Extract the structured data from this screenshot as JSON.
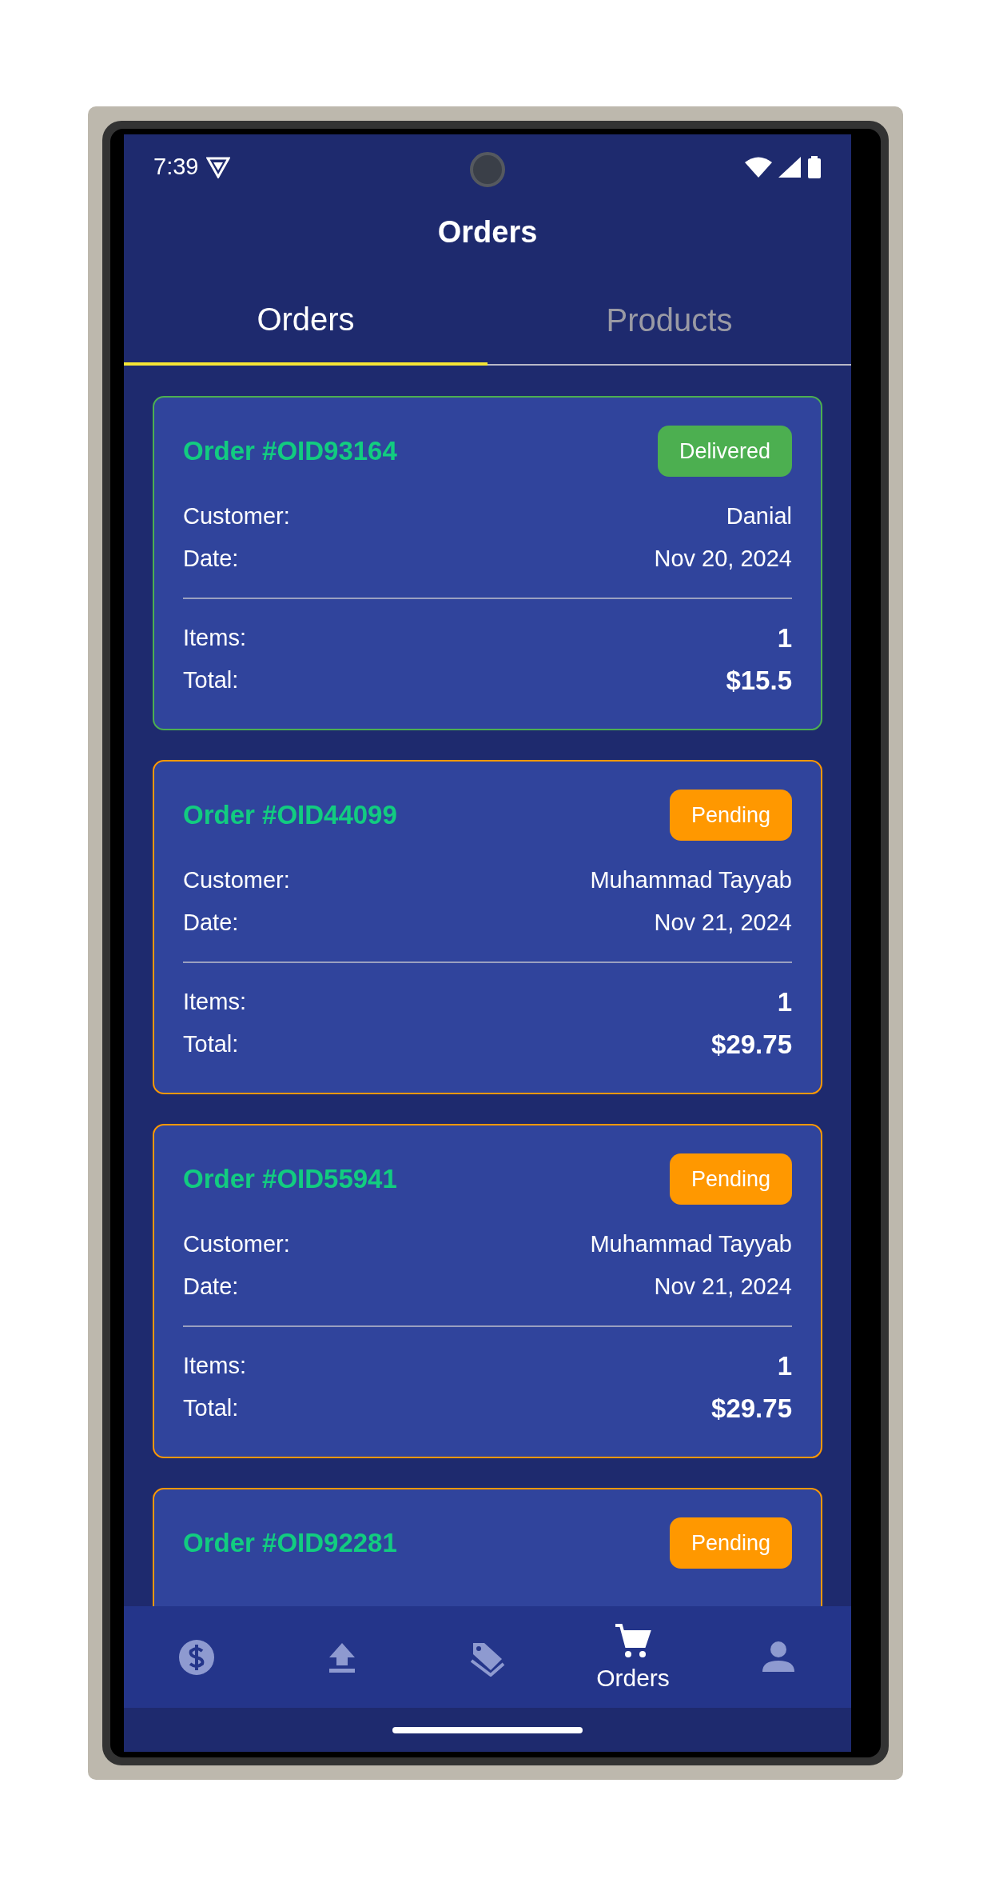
{
  "status_bar": {
    "time": "7:39"
  },
  "title": "Orders",
  "tabs": [
    {
      "label": "Orders",
      "selected": true
    },
    {
      "label": "Products",
      "selected": false
    }
  ],
  "orders": [
    {
      "title": "Order #OID93164",
      "status": "Delivered",
      "kind": "delivered",
      "details": [
        {
          "label": "Customer:",
          "value": "Danial"
        },
        {
          "label": "Date:",
          "value": "Nov 20, 2024"
        }
      ],
      "summary": [
        {
          "label": "Items:",
          "value": "1"
        },
        {
          "label": "Total:",
          "value": "$15.5"
        }
      ]
    },
    {
      "title": "Order #OID44099",
      "status": "Pending",
      "kind": "pending",
      "details": [
        {
          "label": "Customer:",
          "value": "Muhammad Tayyab"
        },
        {
          "label": "Date:",
          "value": "Nov 21, 2024"
        }
      ],
      "summary": [
        {
          "label": "Items:",
          "value": "1"
        },
        {
          "label": "Total:",
          "value": "$29.75"
        }
      ]
    },
    {
      "title": "Order #OID55941",
      "status": "Pending",
      "kind": "pending",
      "details": [
        {
          "label": "Customer:",
          "value": "Muhammad Tayyab"
        },
        {
          "label": "Date:",
          "value": "Nov 21, 2024"
        }
      ],
      "summary": [
        {
          "label": "Items:",
          "value": "1"
        },
        {
          "label": "Total:",
          "value": "$29.75"
        }
      ]
    },
    {
      "title": "Order #OID92281",
      "status": "Pending",
      "kind": "pending"
    }
  ],
  "nav": [
    {
      "kind": "dollar",
      "selected": false
    },
    {
      "kind": "upload",
      "selected": false
    },
    {
      "kind": "tags",
      "selected": false
    },
    {
      "kind": "cart",
      "label": "Orders",
      "selected": true
    },
    {
      "kind": "person",
      "selected": false
    }
  ]
}
